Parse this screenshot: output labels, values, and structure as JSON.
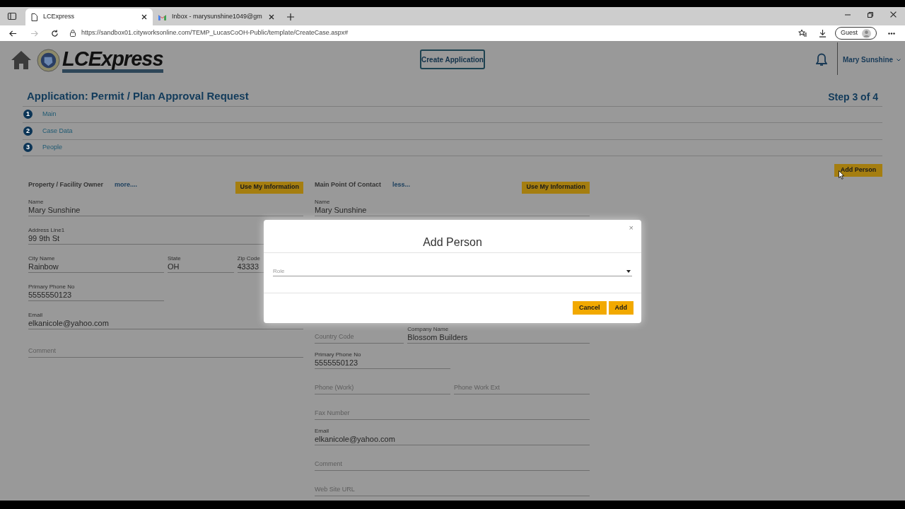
{
  "browser": {
    "tabs": [
      {
        "title": "LCExpress",
        "selected": true,
        "kind": "page"
      },
      {
        "title": "Inbox - marysunshine1049@gm",
        "selected": false,
        "kind": "mail"
      }
    ],
    "url": "https://sandbox01.cityworksonline.com/TEMP_LucasCoOH-Public/template/CreateCase.aspx#",
    "profile": "Guest"
  },
  "header": {
    "logo_text": "LCExpress",
    "create_button": "Create Application",
    "user": "Mary Sunshine"
  },
  "page": {
    "title": "Application: Permit / Plan Approval Request",
    "step": "Step 3 of 4",
    "steps": [
      {
        "number": "1",
        "label": "Main"
      },
      {
        "number": "2",
        "label": "Case Data"
      },
      {
        "number": "3",
        "label": "People"
      }
    ],
    "add_person_button": "Add Person"
  },
  "sections": [
    {
      "title": "Property / Facility Owner",
      "toggle": "more....",
      "use_button": "Use My Information",
      "rows": [
        [
          {
            "label": "Name",
            "value": "Mary Sunshine"
          }
        ],
        [
          {
            "label": "Address Line1",
            "value": "99 9th St"
          }
        ],
        [
          {
            "label": "City Name",
            "value": "Rainbow"
          },
          {
            "label": "State",
            "value": "OH"
          },
          {
            "label": "Zip Code",
            "value": "43333"
          }
        ],
        [
          {
            "label": "Primary Phone No",
            "value": "5555550123"
          }
        ],
        [
          {
            "label": "Email",
            "value": "elkanicole@yahoo.com"
          }
        ],
        [
          {
            "placeholder": "Comment"
          }
        ]
      ]
    },
    {
      "title": "Main Point Of Contact",
      "toggle": "less...",
      "use_button": "Use My Information",
      "rows": [
        [
          {
            "label": "Name",
            "value": "Mary Sunshine"
          }
        ],
        [
          {
            "placeholder": "Country Code"
          },
          {
            "label": "Company Name",
            "value": "Blossom Builders"
          }
        ],
        [
          {
            "label": "Primary Phone No",
            "value": "5555550123"
          }
        ],
        [
          {
            "placeholder": "Phone (Work)"
          },
          {
            "placeholder": "Phone Work Ext"
          }
        ],
        [
          {
            "placeholder": "Fax Number"
          }
        ],
        [
          {
            "label": "Email",
            "value": "elkanicole@yahoo.com"
          }
        ],
        [
          {
            "placeholder": "Comment"
          }
        ],
        [
          {
            "placeholder": "Web Site URL"
          }
        ]
      ]
    }
  ],
  "dialog": {
    "title": "Add Person",
    "close": "×",
    "field": {
      "placeholder": "Role"
    },
    "buttons": [
      "Cancel",
      "Add"
    ]
  }
}
